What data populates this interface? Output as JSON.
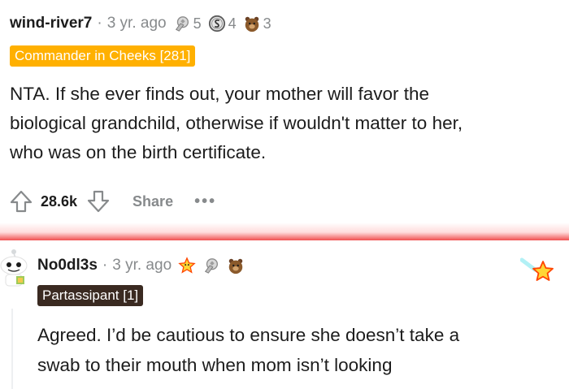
{
  "comment1": {
    "author": "wind-river7",
    "time": "3 yr. ago",
    "awards": [
      {
        "icon": "silver-award-icon",
        "count": "5"
      },
      {
        "icon": "helpful-coin-icon",
        "count": "4"
      },
      {
        "icon": "bear-award-icon",
        "count": "3"
      }
    ],
    "flair": "Commander in Cheeks [281]",
    "body_lines": [
      "NTA. If she ever finds out, your mother will favor the",
      "biological grandchild, otherwise if wouldn't matter to her,",
      "who was on the birth certificate."
    ],
    "score": "28.6k",
    "share_label": "Share",
    "more_label": "•••"
  },
  "comment2": {
    "author": "No0dl3s",
    "time": "3 yr. ago",
    "awards": [
      "wholesome-star-icon",
      "silver-award-icon",
      "bear-award-icon"
    ],
    "flair": "Partassipant [1]",
    "body_lines": [
      "Agreed. I’d be cautious to ensure she doesn’t take a",
      "swab to their mouth when mom isn’t looking"
    ]
  },
  "colors": {
    "flair1_bg": "#ffb000",
    "flair2_bg": "#3a2a21",
    "meta_gray": "#878a8c"
  }
}
